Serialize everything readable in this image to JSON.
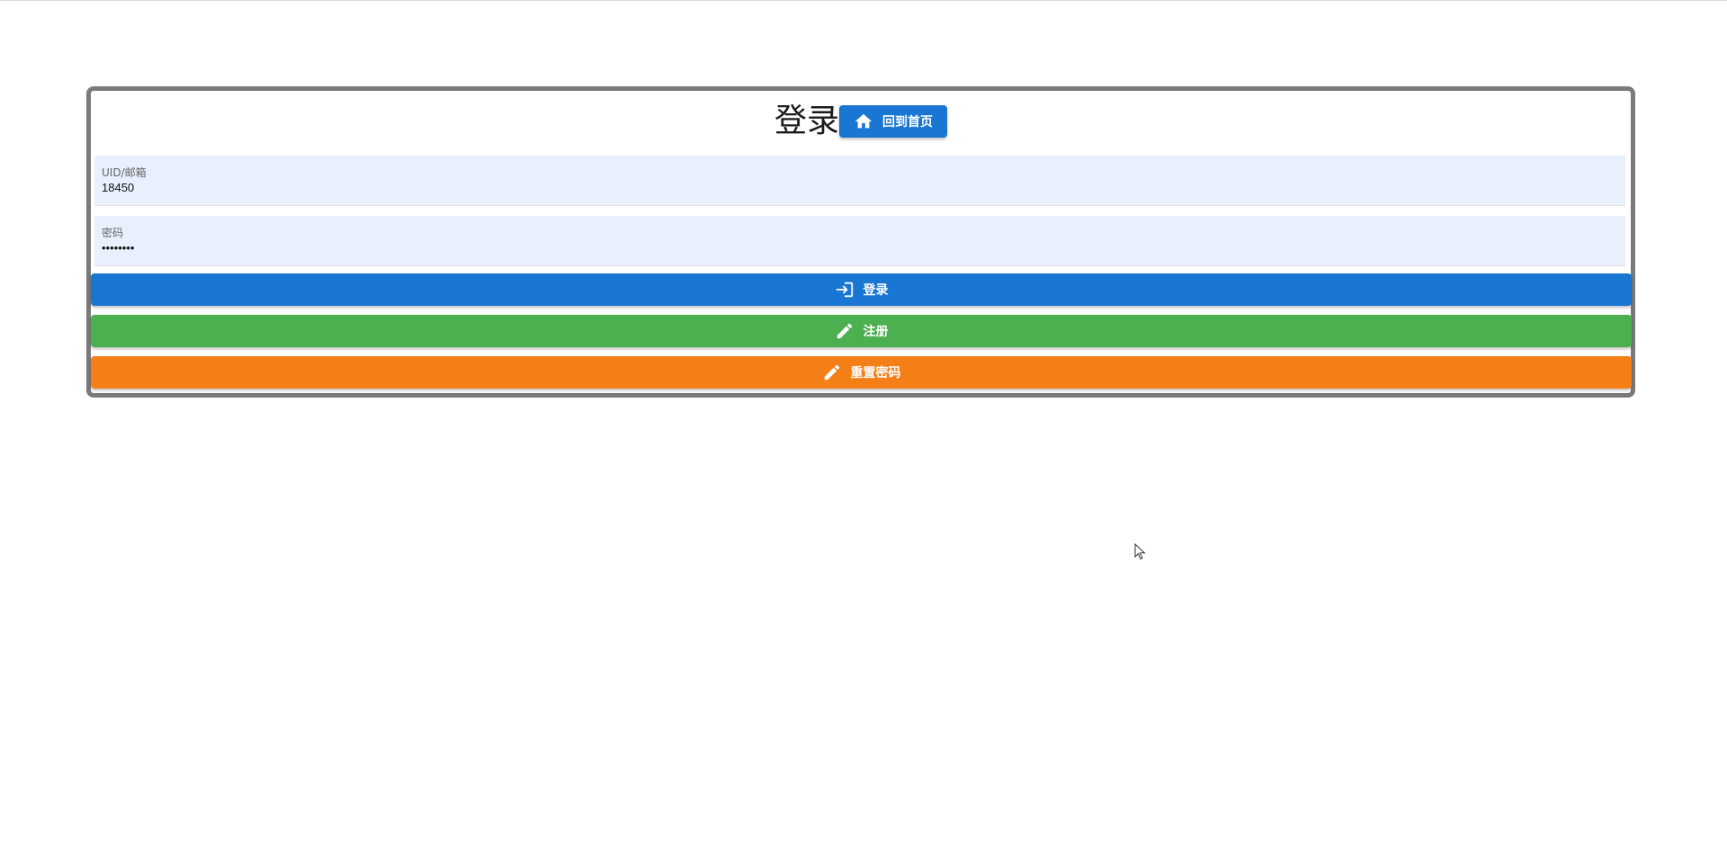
{
  "header": {
    "title": "登录",
    "home_button_label": "回到首页",
    "home_icon": "home-icon"
  },
  "form": {
    "uid_field": {
      "label": "UID/邮箱",
      "value": "18450"
    },
    "password_field": {
      "label": "密码",
      "value": "••••••••"
    }
  },
  "actions": {
    "login_label": "登录",
    "login_icon": "login-icon",
    "register_label": "注册",
    "register_icon": "pencil-icon",
    "reset_label": "重置密码",
    "reset_icon": "pencil-icon"
  },
  "colors": {
    "primary": "#1976d2",
    "success": "#4caf50",
    "warning": "#f57f17",
    "field_bg": "#e8f0fe",
    "card_border": "#7a7a7a"
  }
}
